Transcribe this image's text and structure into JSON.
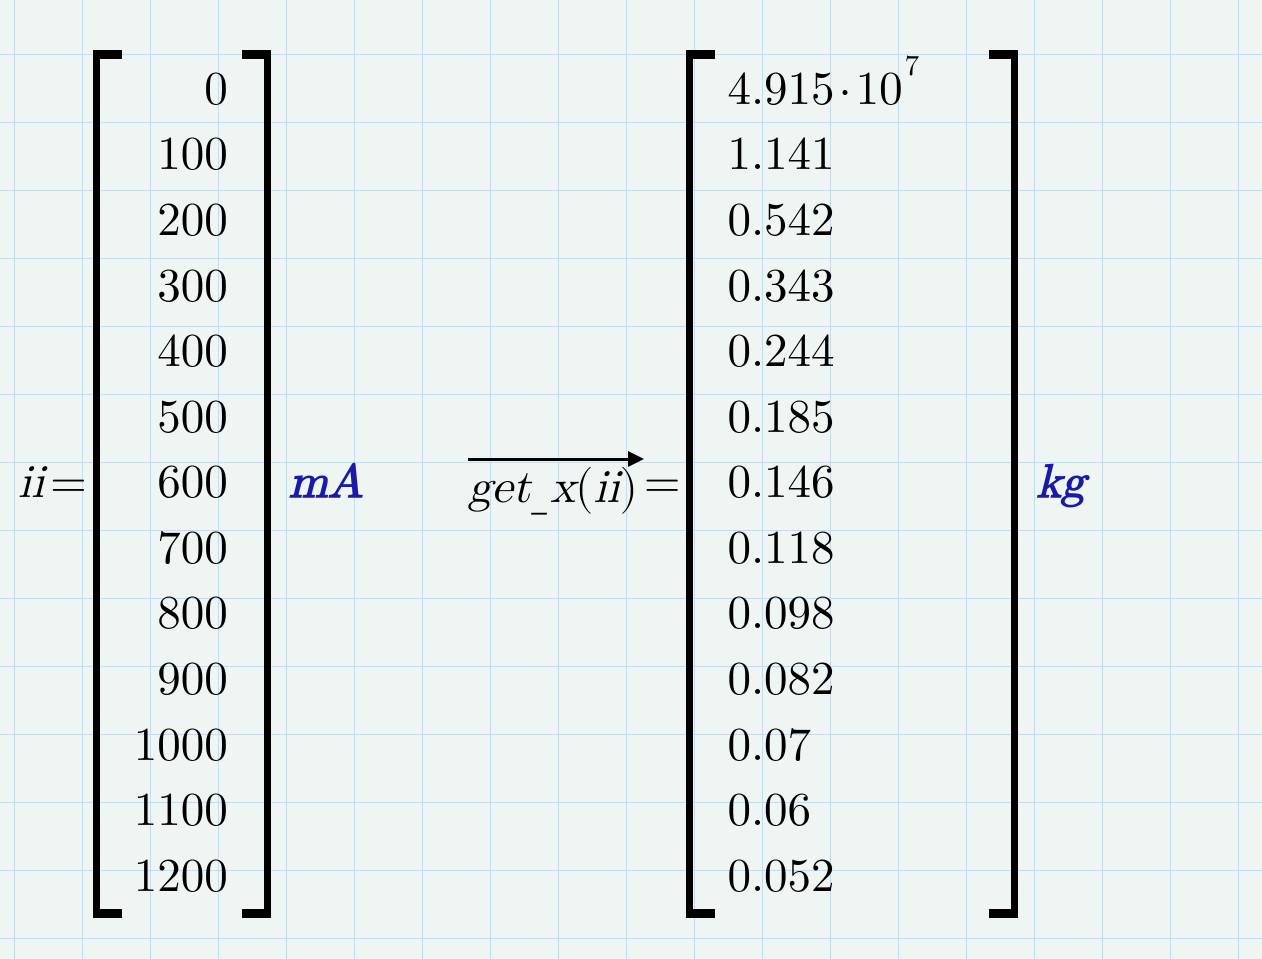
{
  "left": {
    "var": "ii",
    "eq": "=",
    "values": [
      "0",
      "100",
      "200",
      "300",
      "400",
      "500",
      "600",
      "700",
      "800",
      "900",
      "1000",
      "1100",
      "1200"
    ],
    "unit": "mA"
  },
  "right": {
    "fn_name_1": "get",
    "fn_name_2": "x",
    "fn_arg": "ii",
    "eq": "=",
    "values_plain": [
      "",
      "1.141",
      "0.542",
      "0.343",
      "0.244",
      "0.185",
      "0.146",
      "0.118",
      "0.098",
      "0.082",
      "0.07",
      "0.06",
      "0.052"
    ],
    "first_mantissa": "4.915",
    "first_dot": "⋅",
    "first_base": "10",
    "first_exp": "7",
    "unit": "kg"
  },
  "chart_data": {
    "type": "table",
    "title": "",
    "series": [
      {
        "name": "ii (mA)",
        "values": [
          0,
          100,
          200,
          300,
          400,
          500,
          600,
          700,
          800,
          900,
          1000,
          1100,
          1200
        ]
      },
      {
        "name": "get_x(ii) (kg)",
        "values": [
          49150000,
          1.141,
          0.542,
          0.343,
          0.244,
          0.185,
          0.146,
          0.118,
          0.098,
          0.082,
          0.07,
          0.06,
          0.052
        ]
      }
    ]
  }
}
